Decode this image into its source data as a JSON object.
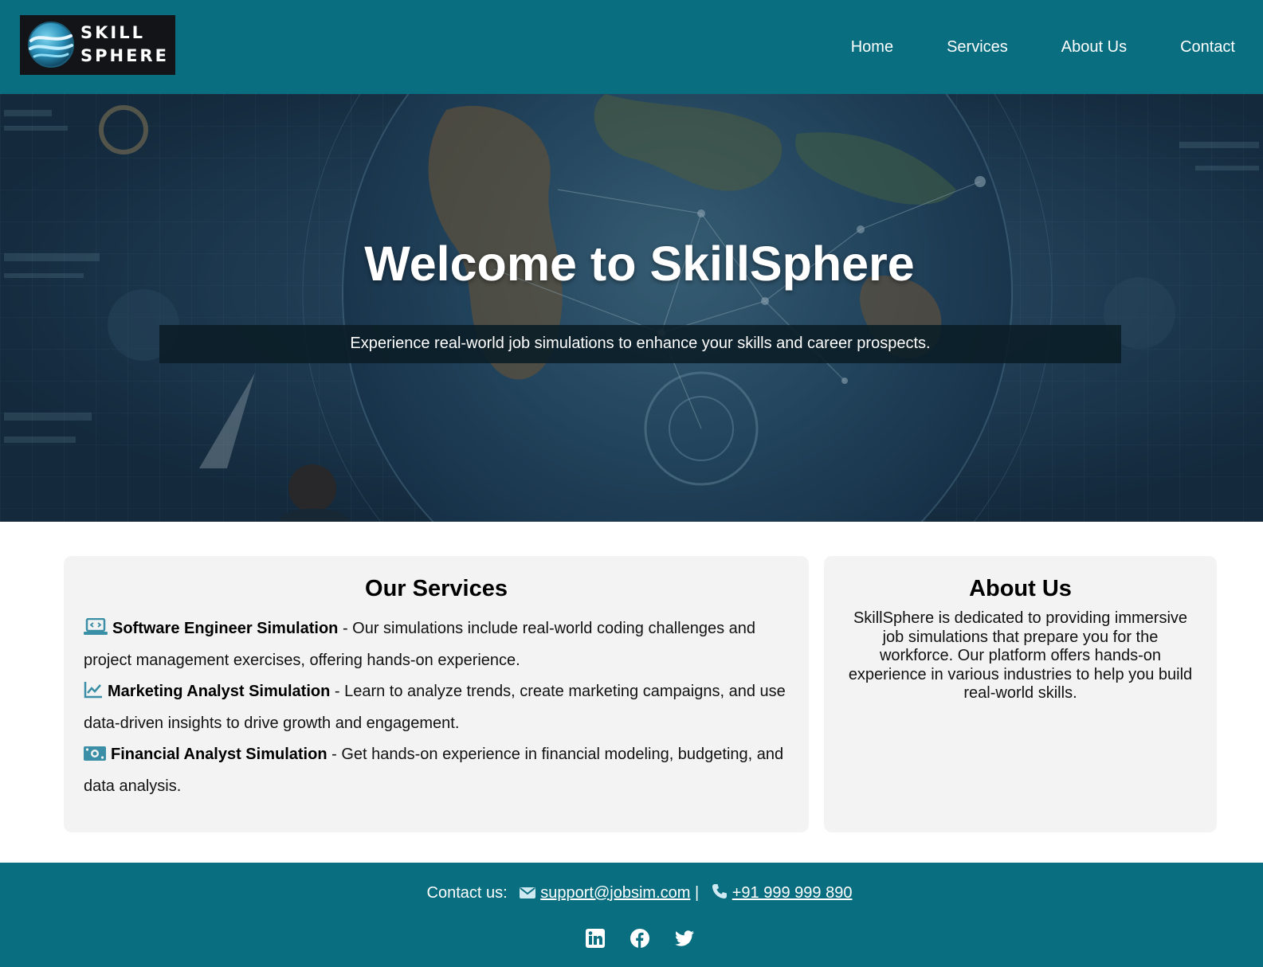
{
  "header": {
    "logo": {
      "line1": "SKILL",
      "line2": "SPHERE"
    },
    "nav": [
      "Home",
      "Services",
      "About Us",
      "Contact"
    ]
  },
  "hero": {
    "title": "Welcome to SkillSphere",
    "subtitle": "Experience real-world job simulations to enhance your skills and career prospects."
  },
  "services": {
    "heading": "Our Services",
    "items": [
      {
        "icon": "laptop-code-icon",
        "title": "Software Engineer Simulation",
        "description": " - Our simulations include real-world coding challenges and project management exercises, offering hands-on experience."
      },
      {
        "icon": "chart-line-icon",
        "title": "Marketing Analyst Simulation",
        "description": " - Learn to analyze trends, create marketing campaigns, and use data-driven insights to drive growth and engagement."
      },
      {
        "icon": "money-bill-icon",
        "title": "Financial Analyst Simulation",
        "description": " - Get hands-on experience in financial modeling, budgeting, and data analysis."
      }
    ]
  },
  "about": {
    "heading": "About Us",
    "text": "SkillSphere is dedicated to providing immersive job simulations that prepare you for the workforce. Our platform offers hands-on experience in various industries to help you build real-world skills."
  },
  "footer": {
    "contact_label": "Contact us:",
    "email": "support@jobsim.com",
    "separator": "|",
    "phone": "+91 999 999 890",
    "socials": [
      "linkedin-icon",
      "facebook-icon",
      "twitter-icon"
    ]
  },
  "colors": {
    "primary": "#086e80",
    "card_bg": "#f3f3f3",
    "icon_accent": "#3a8fa6"
  }
}
